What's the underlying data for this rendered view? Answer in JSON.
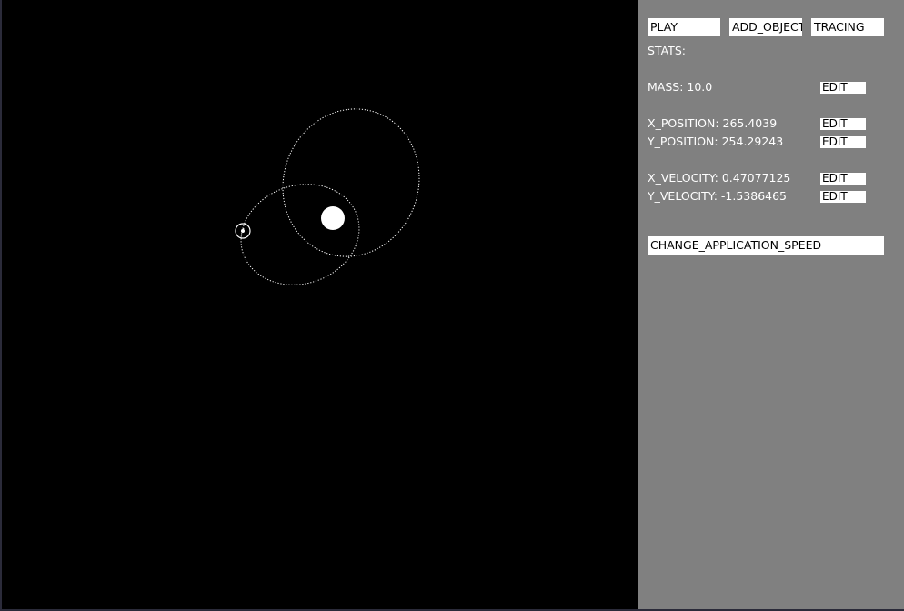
{
  "toolbar": {
    "play_label": "PLAY",
    "add_object_label": "ADD_OBJECT",
    "tracing_label": "TRACING"
  },
  "stats": {
    "header": "STATS:",
    "mass": "MASS: 10.0",
    "x_position": "X_POSITION: 265.4039",
    "y_position": "Y_POSITION: 254.29243",
    "x_velocity": "X_VELOCITY: 0.47077125",
    "y_velocity": "Y_VELOCITY: -1.5386465",
    "edit_label": "EDIT"
  },
  "speed": {
    "label": "CHANGE_APPLICATION_SPEED"
  },
  "colors": {
    "canvas": "#000000",
    "panel": "#808080",
    "button": "#ffffff",
    "text": "#ffffff"
  }
}
